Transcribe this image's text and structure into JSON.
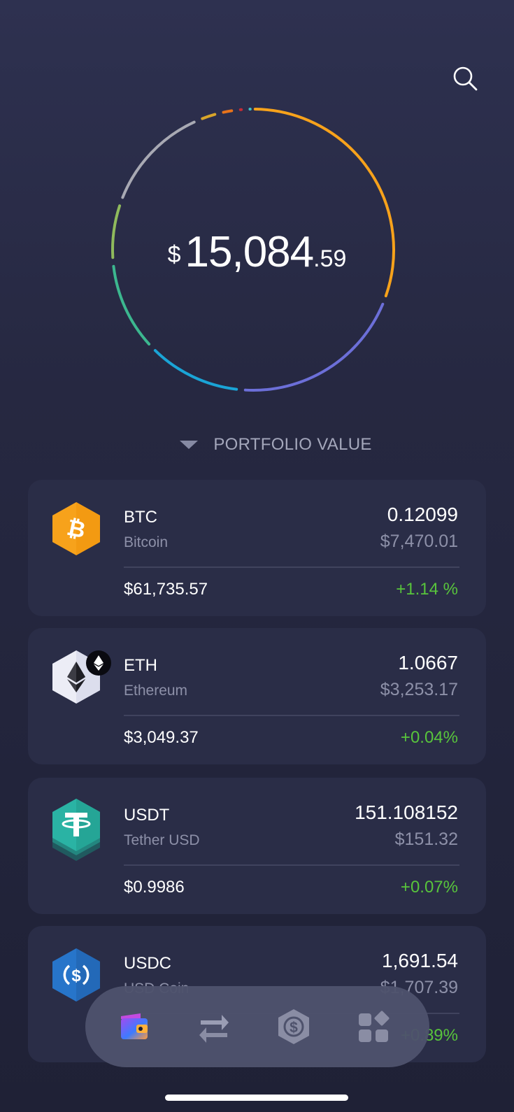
{
  "header": {
    "search_icon": "search-icon"
  },
  "portfolio": {
    "currency_symbol": "$",
    "total_integer": "15,084",
    "total_decimal": ".59",
    "label": "PORTFOLIO VALUE",
    "toggle_icon": "caret-down-icon",
    "ring_colors": [
      "#f7a21b",
      "#6c6fd8",
      "#1aa4d6",
      "#3cb78f",
      "#8fba5c",
      "#a8a9b3",
      "#d9a52a",
      "#e8731b",
      "#c42c36",
      "#3dc1c4"
    ]
  },
  "assets": [
    {
      "symbol": "BTC",
      "name": "Bitcoin",
      "amount": "0.12099",
      "value": "$7,470.01",
      "price": "$61,735.57",
      "change": "+1.14 %",
      "icon": "bitcoin-icon",
      "color": "#f7a21b"
    },
    {
      "symbol": "ETH",
      "name": "Ethereum",
      "amount": "1.0667",
      "value": "$3,253.17",
      "price": "$3,049.37",
      "change": "+0.04%",
      "icon": "ethereum-icon",
      "color": "#ecedf6"
    },
    {
      "symbol": "USDT",
      "name": "Tether USD",
      "amount": "151.108152",
      "value": "$151.32",
      "price": "$0.9986",
      "change": "+0.07%",
      "icon": "tether-icon",
      "color": "#26a69a"
    },
    {
      "symbol": "USDC",
      "name": "USD Coin",
      "amount": "1,691.54",
      "value": "$1,707.39",
      "price": "",
      "change": "+0.89%",
      "icon": "usdc-icon",
      "color": "#2775ca"
    }
  ],
  "tabbar": {
    "tabs": [
      {
        "name": "wallet",
        "icon": "wallet-icon",
        "active": true
      },
      {
        "name": "exchange",
        "icon": "swap-arrows-icon",
        "active": false
      },
      {
        "name": "earn",
        "icon": "dollar-hexagon-icon",
        "active": false
      },
      {
        "name": "apps",
        "icon": "apps-grid-icon",
        "active": false
      }
    ]
  },
  "colors": {
    "positive": "#58c43c",
    "card_bg": "#2a2d47",
    "secondary_text": "#8d90a8"
  }
}
